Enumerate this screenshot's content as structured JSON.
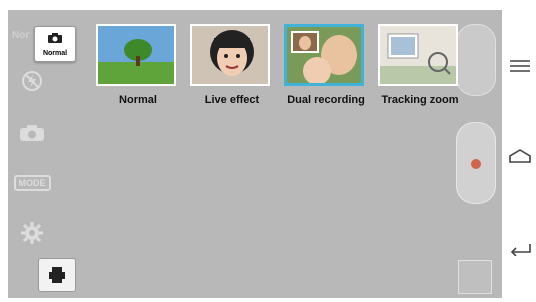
{
  "camera": {
    "top_left_text": "Nor",
    "mode_badge_label": "Normal"
  },
  "modes": [
    {
      "label": "Normal",
      "selected": false
    },
    {
      "label": "Live effect",
      "selected": false
    },
    {
      "label": "Dual recording",
      "selected": true
    },
    {
      "label": "Tracking zoom",
      "selected": false
    }
  ],
  "left_icons": [
    "flash-off-icon",
    "swap-camera-icon",
    "mode-icon",
    "settings-icon"
  ],
  "left_icon_texts": {
    "mode": "MODE"
  },
  "nav": [
    "menu-icon",
    "home-icon",
    "back-icon"
  ],
  "colors": {
    "selected_border": "#3fb3d8",
    "overlay": "#b8b8b8",
    "nav_bg": "#ffffff"
  }
}
